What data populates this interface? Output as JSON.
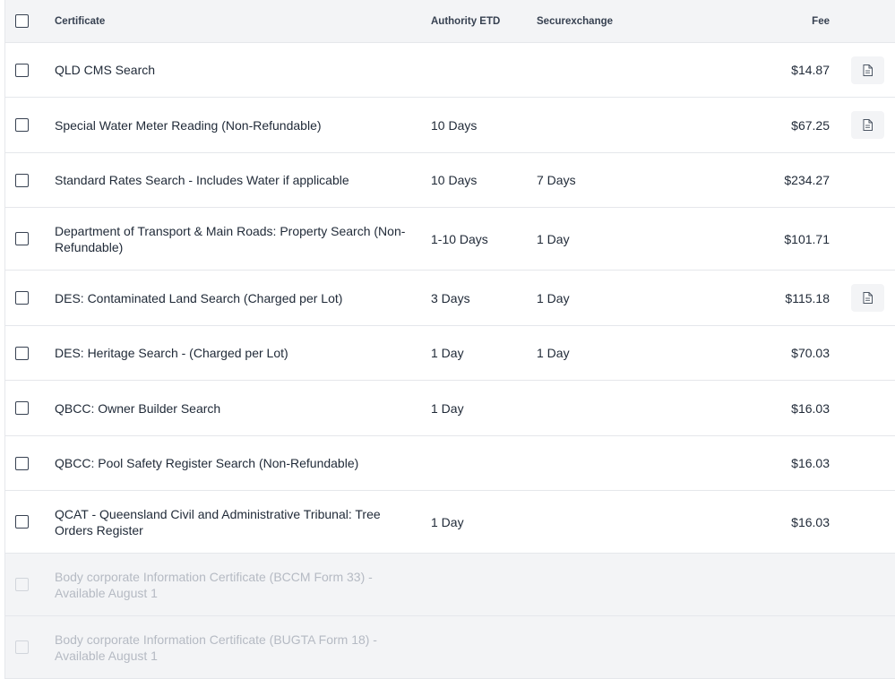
{
  "table": {
    "columns": {
      "certificate": "Certificate",
      "authority_etd": "Authority ETD",
      "securexchange": "Securexchange",
      "fee": "Fee"
    },
    "rows": [
      {
        "name": "QLD CMS Search",
        "etd": "",
        "sec": "",
        "fee": "$14.87",
        "has_doc": true,
        "disabled": false
      },
      {
        "name": "Special Water Meter Reading (Non-Refundable)",
        "etd": "10 Days",
        "sec": "",
        "fee": "$67.25",
        "has_doc": true,
        "disabled": false
      },
      {
        "name": "Standard Rates Search - Includes Water if applicable",
        "etd": "10 Days",
        "sec": "7 Days",
        "fee": "$234.27",
        "has_doc": false,
        "disabled": false
      },
      {
        "name": "Department of Transport & Main Roads: Property Search (Non-Refundable)",
        "etd": "1-10 Days",
        "sec": "1 Day",
        "fee": "$101.71",
        "has_doc": false,
        "disabled": false
      },
      {
        "name": "DES: Contaminated Land Search (Charged per Lot)",
        "etd": "3 Days",
        "sec": "1 Day",
        "fee": "$115.18",
        "has_doc": true,
        "disabled": false
      },
      {
        "name": "DES: Heritage Search - (Charged per Lot)",
        "etd": "1 Day",
        "sec": "1 Day",
        "fee": "$70.03",
        "has_doc": false,
        "disabled": false
      },
      {
        "name": "QBCC: Owner Builder Search",
        "etd": "1 Day",
        "sec": "",
        "fee": "$16.03",
        "has_doc": false,
        "disabled": false
      },
      {
        "name": "QBCC: Pool Safety Register Search (Non-Refundable)",
        "etd": "",
        "sec": "",
        "fee": "$16.03",
        "has_doc": false,
        "disabled": false
      },
      {
        "name": "QCAT - Queensland Civil and Administrative Tribunal: Tree Orders Register",
        "etd": "1 Day",
        "sec": "",
        "fee": "$16.03",
        "has_doc": false,
        "disabled": false
      },
      {
        "name": "Body corporate Information Certificate (BCCM Form 33) - Available August 1",
        "etd": "",
        "sec": "",
        "fee": "",
        "has_doc": false,
        "disabled": true
      },
      {
        "name": "Body corporate Information Certificate (BUGTA Form 18) - Available August 1",
        "etd": "",
        "sec": "",
        "fee": "",
        "has_doc": false,
        "disabled": true
      }
    ]
  },
  "icons": {
    "doc": "document-icon",
    "checkbox": "checkbox-icon"
  },
  "colors": {
    "header_bg": "#f3f4f6",
    "disabled_text": "#b5bac3",
    "border": "#e5e7eb"
  }
}
